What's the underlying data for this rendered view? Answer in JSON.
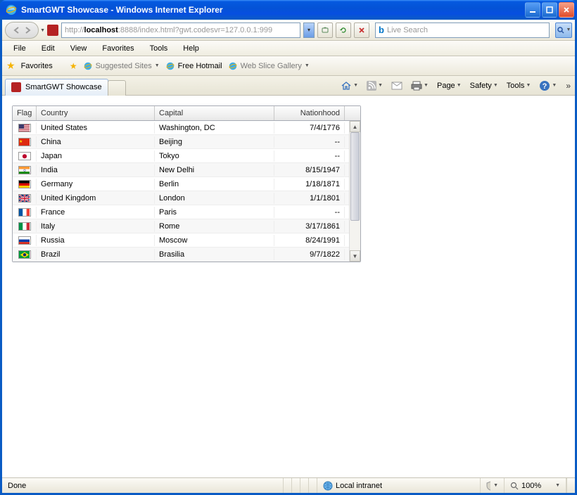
{
  "window": {
    "title": "SmartGWT Showcase - Windows Internet Explorer"
  },
  "nav": {
    "url_host": "localhost",
    "url_prefix": "http://",
    "url_rest": ":8888/index.html?gwt.codesvr=127.0.0.1:999",
    "search_placeholder": "Live Search"
  },
  "menus": [
    "File",
    "Edit",
    "View",
    "Favorites",
    "Tools",
    "Help"
  ],
  "favbar": {
    "label": "Favorites",
    "links": [
      "Suggested Sites",
      "Free Hotmail",
      "Web Slice Gallery"
    ]
  },
  "tab": {
    "label": "SmartGWT Showcase"
  },
  "commandbar": {
    "page": "Page",
    "safety": "Safety",
    "tools": "Tools"
  },
  "grid": {
    "headers": {
      "flag": "Flag",
      "country": "Country",
      "capital": "Capital",
      "nationhood": "Nationhood"
    },
    "rows": [
      {
        "flag": "us",
        "country": "United States",
        "capital": "Washington, DC",
        "nationhood": "7/4/1776"
      },
      {
        "flag": "cn",
        "country": "China",
        "capital": "Beijing",
        "nationhood": "--"
      },
      {
        "flag": "jp",
        "country": "Japan",
        "capital": "Tokyo",
        "nationhood": "--"
      },
      {
        "flag": "in",
        "country": "India",
        "capital": "New Delhi",
        "nationhood": "8/15/1947"
      },
      {
        "flag": "de",
        "country": "Germany",
        "capital": "Berlin",
        "nationhood": "1/18/1871"
      },
      {
        "flag": "gb",
        "country": "United Kingdom",
        "capital": "London",
        "nationhood": "1/1/1801"
      },
      {
        "flag": "fr",
        "country": "France",
        "capital": "Paris",
        "nationhood": "--"
      },
      {
        "flag": "it",
        "country": "Italy",
        "capital": "Rome",
        "nationhood": "3/17/1861"
      },
      {
        "flag": "ru",
        "country": "Russia",
        "capital": "Moscow",
        "nationhood": "8/24/1991"
      },
      {
        "flag": "br",
        "country": "Brazil",
        "capital": "Brasilia",
        "nationhood": "9/7/1822"
      }
    ]
  },
  "status": {
    "done": "Done",
    "zone": "Local intranet",
    "zoom": "100%"
  },
  "flags": {
    "us": "<svg viewBox='0 0 18 12'><rect width='18' height='12' fill='#B22234'/><g fill='#fff'><rect y='1' width='18' height='1'/><rect y='3' width='18' height='1'/><rect y='5' width='18' height='1'/><rect y='7' width='18' height='1'/><rect y='9' width='18' height='1'/><rect y='11' width='18' height='1'/></g><rect width='8' height='6.5' fill='#3C3B6E'/></svg>",
    "cn": "<svg viewBox='0 0 18 12'><rect width='18' height='12' fill='#DE2910'/><polygon fill='#FFDE00' points='3,2 3.6,3.8 5.5,3.8 4,4.9 4.6,6.7 3,5.6 1.4,6.7 2,4.9 0.5,3.8 2.4,3.8'/></svg>",
    "jp": "<svg viewBox='0 0 18 12'><rect width='18' height='12' fill='#fff'/><circle cx='9' cy='6' r='3.5' fill='#BC002D'/></svg>",
    "in": "<svg viewBox='0 0 18 12'><rect width='18' height='4' fill='#FF9933'/><rect y='4' width='18' height='4' fill='#fff'/><rect y='8' width='18' height='4' fill='#138808'/><circle cx='9' cy='6' r='1.5' fill='none' stroke='#000080' stroke-width='0.5'/></svg>",
    "de": "<svg viewBox='0 0 18 12'><rect width='18' height='4' fill='#000'/><rect y='4' width='18' height='4' fill='#DD0000'/><rect y='8' width='18' height='4' fill='#FFCE00'/></svg>",
    "gb": "<svg viewBox='0 0 18 12'><rect width='18' height='12' fill='#012169'/><path d='M0 0L18 12M18 0L0 12' stroke='#fff' stroke-width='2.4'/><path d='M0 0L18 12M18 0L0 12' stroke='#C8102E' stroke-width='1'/><path d='M9 0V12M0 6H18' stroke='#fff' stroke-width='3'/><path d='M9 0V12M0 6H18' stroke='#C8102E' stroke-width='1.6'/></svg>",
    "fr": "<svg viewBox='0 0 18 12'><rect width='6' height='12' fill='#0055A4'/><rect x='6' width='6' height='12' fill='#fff'/><rect x='12' width='6' height='12' fill='#EF4135'/></svg>",
    "it": "<svg viewBox='0 0 18 12'><rect width='6' height='12' fill='#009246'/><rect x='6' width='6' height='12' fill='#fff'/><rect x='12' width='6' height='12' fill='#CE2B37'/></svg>",
    "ru": "<svg viewBox='0 0 18 12'><rect width='18' height='4' fill='#fff'/><rect y='4' width='18' height='4' fill='#0039A6'/><rect y='8' width='18' height='4' fill='#D52B1E'/></svg>",
    "br": "<svg viewBox='0 0 18 12'><rect width='18' height='12' fill='#009B3A'/><polygon points='9,1.5 16,6 9,10.5 2,6' fill='#FEDF00'/><circle cx='9' cy='6' r='2.5' fill='#002776'/></svg>"
  }
}
